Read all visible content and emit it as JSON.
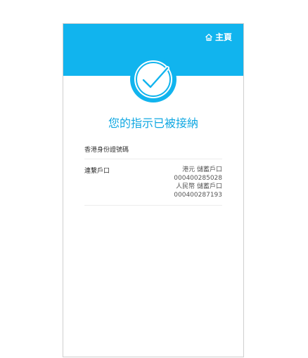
{
  "header": {
    "home_label": "主頁",
    "color": "#11b4ee"
  },
  "status": {
    "icon": "check-circle-icon",
    "title": "您的指示已被接納"
  },
  "details": {
    "id_label": "香港身份證號碼",
    "linked_label": "連繫戶口",
    "accounts": [
      {
        "type": "港元 儲蓄戶口",
        "number": "000400285028"
      },
      {
        "type": "人民幣 儲蓄戶口",
        "number": "000400287193"
      }
    ]
  }
}
